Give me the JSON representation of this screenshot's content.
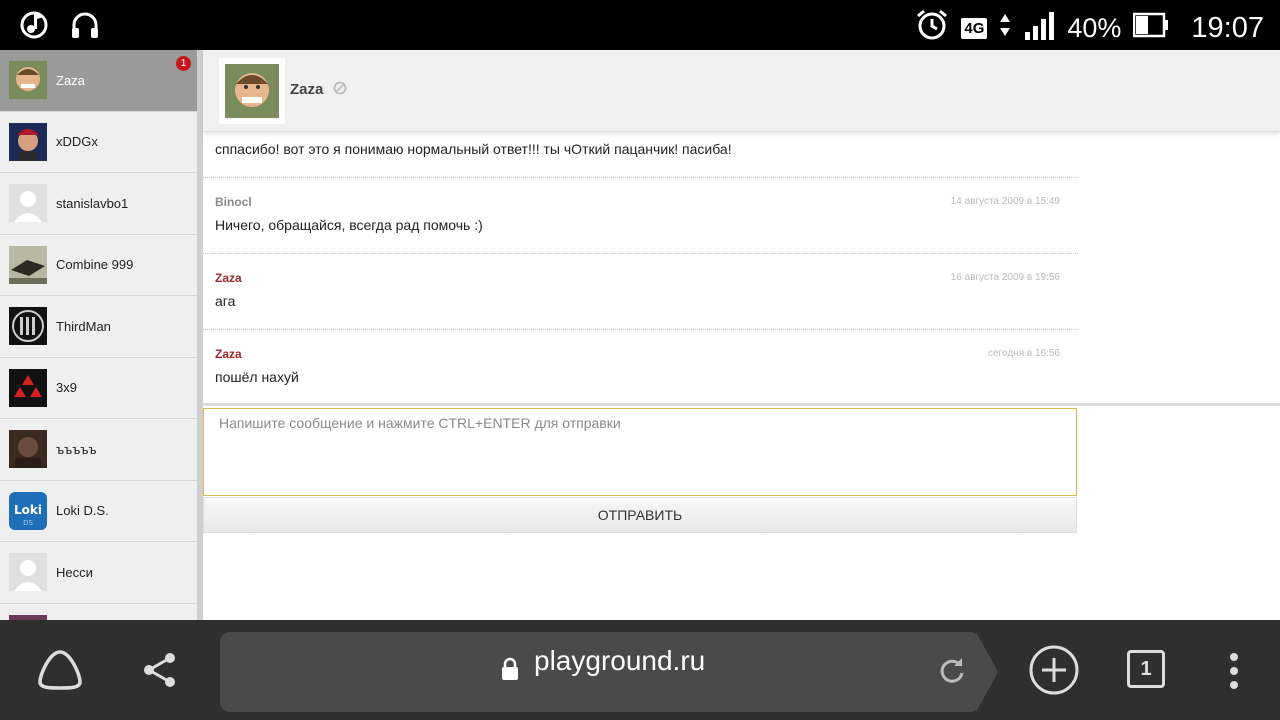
{
  "status_bar": {
    "battery_percent": "40%",
    "network": "4G",
    "time": "19:07"
  },
  "sidebar": {
    "contacts": [
      {
        "name": "Zaza",
        "unread": "1",
        "active": true
      },
      {
        "name": "xDDGx"
      },
      {
        "name": "stanislavbo1"
      },
      {
        "name": "Combine 999"
      },
      {
        "name": "ThirdMan"
      },
      {
        "name": "3x9"
      },
      {
        "name": "ъъъъъ"
      },
      {
        "name": "Loki D.S."
      },
      {
        "name": "Несси"
      }
    ]
  },
  "chat": {
    "contact_name": "Zaza",
    "messages": [
      {
        "author": "",
        "time": "",
        "text": "сппасибо! вот это я понимаю нормальный ответ!!! ты чОткий пацанчик! пасиба!"
      },
      {
        "author": "Binocl",
        "time": "14 августа 2009 в 15:49",
        "text": "Ничего, обращайся, всегда рад помочь :)"
      },
      {
        "author": "Zaza",
        "time": "16 августа 2009 в 19:56",
        "text": "ага"
      },
      {
        "author": "Zaza",
        "time": "сегодня в 16:56",
        "text": "пошёл нахуй"
      }
    ],
    "composer_placeholder": "Напишите сообщение и нажмите CTRL+ENTER для отправки",
    "send_label": "ОТПРАВИТЬ"
  },
  "browser": {
    "url": "playground.ru",
    "tab_count": "1"
  },
  "colors": {
    "author_zaza": "#9b2a2a",
    "author_other": "#8a8a8a",
    "composer_border": "#e2b84c",
    "badge": "#c9161d"
  }
}
